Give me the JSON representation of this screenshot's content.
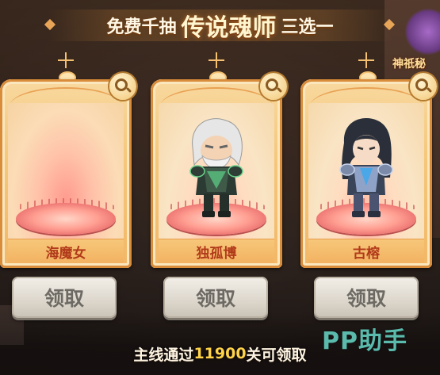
{
  "title": {
    "prefix": "免费千抽",
    "highlight": "传说魂师",
    "suffix": "三选一"
  },
  "side_event": {
    "label": "神祇秘"
  },
  "cards": [
    {
      "name": "海魔女",
      "claim_label": "领取",
      "has_hero": false,
      "inspect_icon": "magnifier-icon"
    },
    {
      "name": "独孤博",
      "claim_label": "领取",
      "has_hero": true,
      "inspect_icon": "magnifier-icon"
    },
    {
      "name": "古榕",
      "claim_label": "领取",
      "has_hero": true,
      "inspect_icon": "magnifier-icon"
    }
  ],
  "footer": {
    "prefix": "主线通过",
    "stage": "11900",
    "suffix": "关可领取"
  },
  "watermark": "PP助手",
  "colors": {
    "card_frame": "#f5c87c",
    "platform": "#ff9f92",
    "name_text": "#b13a1a",
    "footer_highlight": "#ffd44a",
    "button": "#dcd6cc"
  }
}
